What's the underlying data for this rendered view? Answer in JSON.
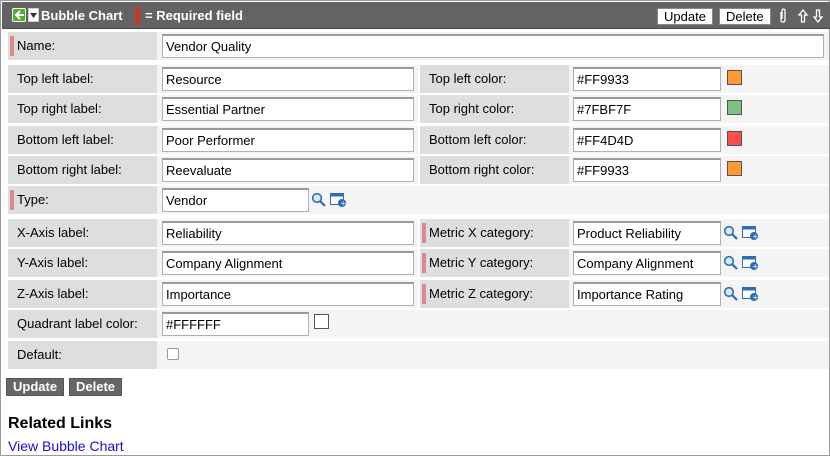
{
  "header": {
    "title": "Bubble Chart",
    "required_legend": "= Required field",
    "update_label": "Update",
    "delete_label": "Delete",
    "icons": [
      "back-arrow-icon",
      "dropdown-icon",
      "paperclip-icon",
      "up-arrow-icon",
      "down-arrow-icon"
    ]
  },
  "form": {
    "name": {
      "label": "Name:",
      "value": "Vendor Quality"
    },
    "top_left_label": {
      "label": "Top left label:",
      "value": "Resource"
    },
    "top_left_color": {
      "label": "Top left color:",
      "value": "#FF9933",
      "swatch": "#FF9933"
    },
    "top_right_label": {
      "label": "Top right label:",
      "value": "Essential Partner"
    },
    "top_right_color": {
      "label": "Top right color:",
      "value": "#7FBF7F",
      "swatch": "#7FBF7F"
    },
    "bottom_left_label": {
      "label": "Bottom left label:",
      "value": "Poor Performer"
    },
    "bottom_left_color": {
      "label": "Bottom left color:",
      "value": "#FF4D4D",
      "swatch": "#FF4D4D"
    },
    "bottom_right_label": {
      "label": "Bottom right label:",
      "value": "Reevaluate"
    },
    "bottom_right_color": {
      "label": "Bottom right color:",
      "value": "#FF9933",
      "swatch": "#FF9933"
    },
    "type": {
      "label": "Type:",
      "value": "Vendor"
    },
    "x_axis_label": {
      "label": "X-Axis label:",
      "value": "Reliability"
    },
    "metric_x": {
      "label": "Metric X category:",
      "value": "Product Reliability"
    },
    "y_axis_label": {
      "label": "Y-Axis label:",
      "value": "Company Alignment"
    },
    "metric_y": {
      "label": "Metric Y category:",
      "value": "Company Alignment"
    },
    "z_axis_label": {
      "label": "Z-Axis label:",
      "value": "Importance"
    },
    "metric_z": {
      "label": "Metric Z category:",
      "value": "Importance Rating"
    },
    "quadrant_label_color": {
      "label": "Quadrant label color:",
      "value": "#FFFFFF",
      "swatch": "#FFFFFF"
    },
    "default": {
      "label": "Default:",
      "checked": false
    }
  },
  "footer": {
    "update_label": "Update",
    "delete_label": "Delete"
  },
  "related_links": {
    "title": "Related Links",
    "links": [
      "View Bubble Chart"
    ]
  }
}
